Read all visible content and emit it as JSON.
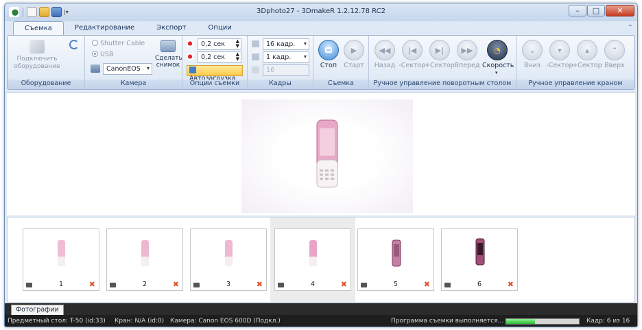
{
  "window": {
    "title": "3Dphoto27 - 3DmakeR 1.2.12.78 RC2",
    "qat_icons": [
      "undo-icon",
      "new-file-icon",
      "open-folder-icon",
      "save-icon"
    ]
  },
  "ribbon_tabs": [
    {
      "label": "Съемка",
      "active": true
    },
    {
      "label": "Редактирование",
      "active": false
    },
    {
      "label": "Экспорт",
      "active": false
    },
    {
      "label": "Опции",
      "active": false
    }
  ],
  "groups": {
    "equipment": {
      "title": "Оборудование",
      "connect_label": "Подключить оборудование"
    },
    "camera": {
      "title": "Камера",
      "shutter_cable": "Shutter Cable",
      "usb": "USB",
      "selected_source": "USB",
      "camera_model": "CanonEOS",
      "snapshot_label": "Сделать снимок"
    },
    "shooting_options": {
      "title": "Опции съемки",
      "delay1": "0,2 сек",
      "delay2": "0,2 сек",
      "autoload_label": "Автозагрузка"
    },
    "frames": {
      "title": "Кадры",
      "frames_count": "16 кадр.",
      "step": "1 кадр.",
      "disabled_value": "16"
    },
    "shooting": {
      "title": "Съемка",
      "stop_label": "Стоп",
      "start_label": "Старт"
    },
    "turntable": {
      "title": "Ручное управление поворотным столом",
      "buttons": [
        "Назад",
        "-Сектор",
        "+Сектор",
        "Вперед",
        "Скорость"
      ]
    },
    "crane": {
      "title": "Ручное управление краном",
      "buttons": [
        "Вниз",
        "-Сектор",
        "+Сектор",
        "Вверх"
      ]
    }
  },
  "thumbnails": [
    {
      "number": "1"
    },
    {
      "number": "2"
    },
    {
      "number": "3"
    },
    {
      "number": "4"
    },
    {
      "number": "5"
    },
    {
      "number": "6"
    }
  ],
  "selected_thumbnail": "4",
  "bottom_tab": "Фотографии",
  "status": {
    "table": "Предметный стол:  T-50 (id:33)",
    "crane": "Кран:  N/A (id:0)",
    "camera": "Камера:  Canon EOS 600D (Подкл.)",
    "program": "Программа съемки выполняется...",
    "progress": 0.4,
    "frame": "Кадр:  6  из  16"
  },
  "colors": {
    "ribbon_bg": "#dbe6f3",
    "accent_blue": "#3e88d6",
    "autoload_highlight": "#ffd56a",
    "delete_x": "#e0502a",
    "progress_green": "#2bbd3a",
    "status_bg": "#1e1e1e"
  }
}
